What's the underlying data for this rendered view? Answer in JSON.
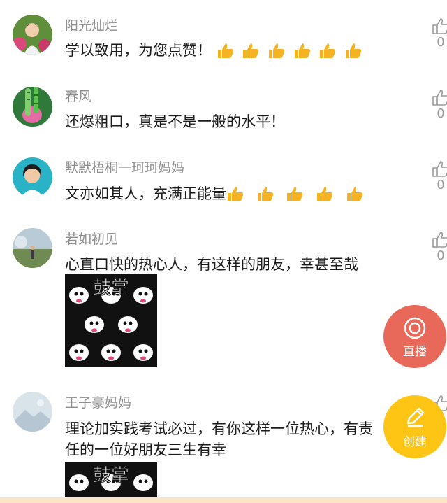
{
  "comments": [
    {
      "user": "阳光灿烂",
      "text": "学以致用，为您点赞！",
      "likes": "0",
      "thumbs": 6
    },
    {
      "user": "春风",
      "text": "还爆粗口，真是不是一般的水平！",
      "likes": "0",
      "thumbs": 0
    },
    {
      "user": "默默梧桐一珂珂妈妈",
      "text": "文亦如其人，充满正能量",
      "likes": "0",
      "thumbs": 5
    },
    {
      "user": "若如初见",
      "text": "心直口快的热心人，有这样的朋友，幸甚至哉",
      "likes": "0",
      "sticker_text": "鼓掌"
    },
    {
      "user": "王子豪妈妈",
      "text": "理论加实践考试必过，有你这样一位热心，有责任的一位好朋友三生有幸",
      "likes": "",
      "sticker_text": "鼓掌"
    }
  ],
  "fab": {
    "live_label": "直播",
    "create_label": "创建"
  },
  "colors": {
    "live": "#e8685a",
    "create": "#ffc515",
    "thumb": "#f5b324"
  }
}
